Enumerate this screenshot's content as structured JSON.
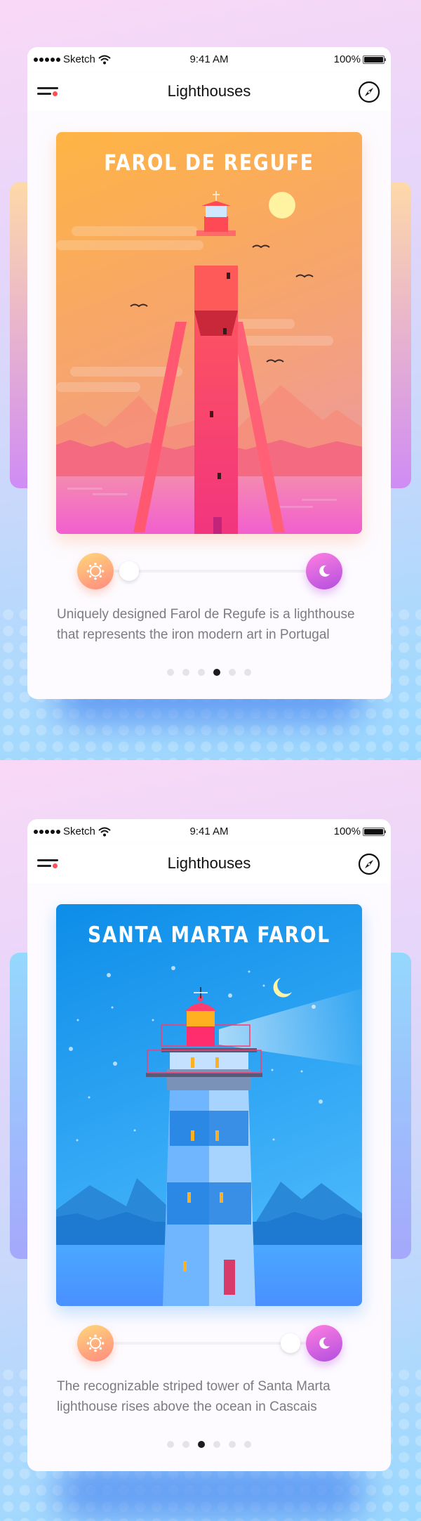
{
  "screens": [
    {
      "status_bar": {
        "carrier": "Sketch",
        "time": "9:41 AM",
        "battery": "100%"
      },
      "navbar": {
        "title": "Lighthouses",
        "left_icon": "menu-icon",
        "right_icon": "compass-icon"
      },
      "card": {
        "title": "FAROL DE REGUFE",
        "theme": "day",
        "colors": {
          "sky_top": "#ffb444",
          "sky_bottom": "#f2a0a0",
          "water": "#f668c8",
          "tower": "#ff5060"
        }
      },
      "day_night_slider": {
        "start_icon": "sun-icon",
        "end_icon": "moon-icon",
        "value": 0.05
      },
      "description": "Uniquely designed Farol de Regufe is a lighthouse that represents the iron modern art in Portugal",
      "pagination": {
        "total": 6,
        "active_index": 3
      }
    },
    {
      "status_bar": {
        "carrier": "Sketch",
        "time": "9:41 AM",
        "battery": "100%"
      },
      "navbar": {
        "title": "Lighthouses",
        "left_icon": "menu-icon",
        "right_icon": "compass-icon"
      },
      "card": {
        "title": "SANTA MARTA FAROL",
        "theme": "night",
        "colors": {
          "sky_top": "#0f8ee8",
          "sky_bottom": "#46b4fb",
          "water": "#4aa0ff",
          "tower": "#8ec8ff"
        }
      },
      "day_night_slider": {
        "start_icon": "sun-icon",
        "end_icon": "moon-icon",
        "value": 0.94
      },
      "description": "The recognizable striped tower of Santa Marta lighthouse rises above the ocean in Cascais",
      "pagination": {
        "total": 6,
        "active_index": 2
      }
    }
  ]
}
